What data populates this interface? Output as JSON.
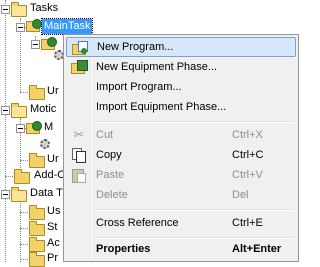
{
  "tree": {
    "items": [
      {
        "label": "Tasks"
      },
      {
        "label": "MainTask"
      },
      {
        "label": "Ur"
      },
      {
        "label": "Motic"
      },
      {
        "label": "M"
      },
      {
        "label": "Ur"
      },
      {
        "label": "Add-C"
      },
      {
        "label": "Data T"
      },
      {
        "label": "Us"
      },
      {
        "label": "St"
      },
      {
        "label": "Ac"
      },
      {
        "label": "Pr"
      }
    ]
  },
  "context_menu": {
    "items": [
      {
        "label": "New Program...",
        "shortcut": "",
        "state": "highlighted",
        "icon": "new-program-icon"
      },
      {
        "label": "New Equipment Phase...",
        "shortcut": "",
        "state": "enabled",
        "icon": "new-equipment-phase-icon"
      },
      {
        "label": "Import Program...",
        "shortcut": "",
        "state": "enabled",
        "icon": ""
      },
      {
        "label": "Import Equipment Phase...",
        "shortcut": "",
        "state": "enabled",
        "icon": ""
      },
      {
        "label": "Cut",
        "shortcut": "Ctrl+X",
        "state": "disabled",
        "icon": "scissors-icon"
      },
      {
        "label": "Copy",
        "shortcut": "Ctrl+C",
        "state": "enabled",
        "icon": "copy-icon"
      },
      {
        "label": "Paste",
        "shortcut": "Ctrl+V",
        "state": "disabled",
        "icon": "paste-icon"
      },
      {
        "label": "Delete",
        "shortcut": "Del",
        "state": "disabled",
        "icon": ""
      },
      {
        "label": "Cross Reference",
        "shortcut": "Ctrl+E",
        "state": "enabled",
        "icon": ""
      },
      {
        "label": "Properties",
        "shortcut": "Alt+Enter",
        "state": "bold",
        "icon": ""
      }
    ]
  },
  "colors": {
    "selection": "#3399ff",
    "menu_background": "#f0f0f0",
    "menu_highlight": "#d5e7f8",
    "disabled_text": "#8d8d8d",
    "folder": "#f2d36b"
  }
}
